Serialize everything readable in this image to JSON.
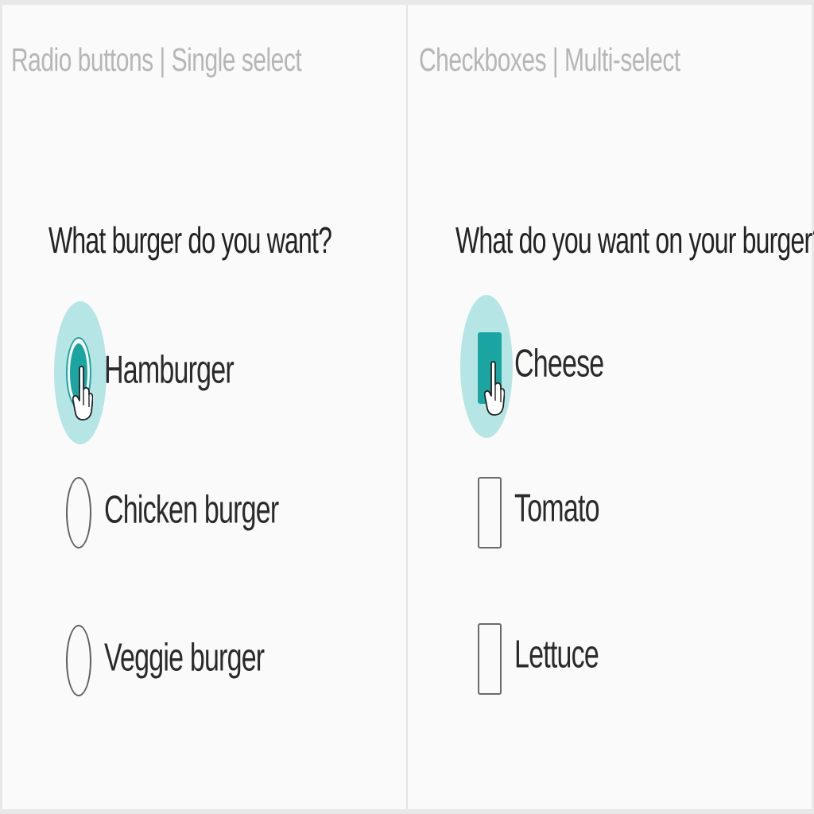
{
  "radio_panel": {
    "caption": "Radio buttons | Single select",
    "question": "What burger do you want?",
    "options": [
      {
        "label": "Hamburger",
        "checked": true
      },
      {
        "label": "Chicken burger",
        "checked": false
      },
      {
        "label": "Veggie burger",
        "checked": false
      }
    ]
  },
  "checkbox_panel": {
    "caption": "Checkboxes | Multi-select",
    "question": "What do you want on your burger?",
    "options": [
      {
        "label": "Cheese",
        "checked": true
      },
      {
        "label": "Tomato",
        "checked": false
      },
      {
        "label": "Lettuce",
        "checked": false
      }
    ]
  },
  "colors": {
    "accent": "#1aa5a3",
    "focus_halo": "#b6e5e6",
    "caption_text": "#b6b6b6",
    "body_text": "#222222",
    "background": "#fafafa"
  },
  "icons": {
    "pointer": "hand-pointer-icon"
  }
}
